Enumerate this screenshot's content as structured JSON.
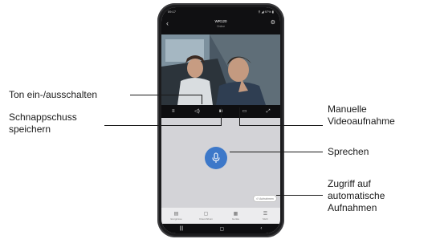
{
  "phone": {
    "status_bar": {
      "time": "09:17",
      "indicators": "⚲ ◢ 97% ▮"
    },
    "title_bar": {
      "device_name": "WR120",
      "subtitle": "Online"
    },
    "video_toolbar": {
      "icons": [
        "settings-icon",
        "speaker-icon",
        "camera-icon",
        "record-icon",
        "fullscreen-icon"
      ]
    },
    "talk": {
      "icon": "microphone-icon"
    },
    "recordings_button": {
      "label": "Aufnahmen",
      "icon": "history-icon"
    },
    "bottom_nav": [
      {
        "label": "Ereignisse",
        "icon": "events-icon"
      },
      {
        "label": "Cloud Album",
        "icon": "album-icon"
      },
      {
        "label": "Geräte",
        "icon": "devices-icon"
      },
      {
        "label": "Mehr",
        "icon": "menu-icon"
      }
    ],
    "system_nav": [
      "recent-apps-icon",
      "home-icon",
      "back-icon"
    ]
  },
  "callouts": {
    "toggle_sound": "Ton ein-/ausschalten",
    "snapshot_line1": "Schnappschuss",
    "snapshot_line2": "speichern",
    "video_line1": "Manuelle",
    "video_line2": "Videoaufnahme",
    "speak": "Sprechen",
    "auto_line1": "Zugriff auf",
    "auto_line2": "automatische",
    "auto_line3": "Aufnahmen"
  }
}
